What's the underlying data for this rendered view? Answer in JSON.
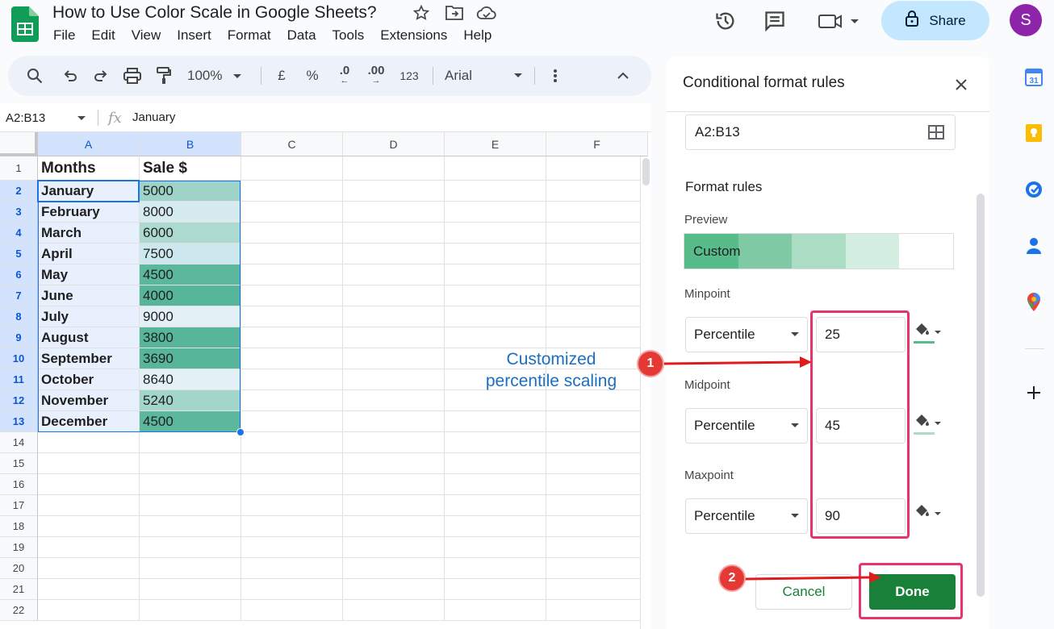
{
  "app": {
    "title": "How to Use Color Scale in Google Sheets?",
    "menu": [
      "File",
      "Edit",
      "View",
      "Insert",
      "Format",
      "Data",
      "Tools",
      "Extensions",
      "Help"
    ],
    "share_label": "Share",
    "avatar_initial": "S"
  },
  "toolbar": {
    "zoom": "100%",
    "currency": "£",
    "percent": "%",
    "dec_decrease": ".0",
    "dec_increase": ".00",
    "number_format": "123",
    "font": "Arial"
  },
  "formula_bar": {
    "name_box": "A2:B13",
    "fx": "fx",
    "content": "January"
  },
  "sheet": {
    "columns": [
      "A",
      "B",
      "C",
      "D",
      "E",
      "F"
    ],
    "rows": [
      "1",
      "2",
      "3",
      "4",
      "5",
      "6",
      "7",
      "8",
      "9",
      "10",
      "11",
      "12",
      "13",
      "14",
      "15",
      "16",
      "17",
      "18",
      "19",
      "20",
      "21",
      "22"
    ],
    "header": {
      "a": "Months",
      "b": "Sale $"
    },
    "data": [
      {
        "month": "January",
        "sale": "5000",
        "color": "#9dd4c7"
      },
      {
        "month": "February",
        "sale": "8000",
        "color": "#d6ebf0"
      },
      {
        "month": "March",
        "sale": "6000",
        "color": "#acdad0"
      },
      {
        "month": "April",
        "sale": "7500",
        "color": "#cde8ee"
      },
      {
        "month": "May",
        "sale": "4500",
        "color": "#5bb89d"
      },
      {
        "month": "June",
        "sale": "4000",
        "color": "#57b69a"
      },
      {
        "month": "July",
        "sale": "9000",
        "color": "#e3f0f6"
      },
      {
        "month": "August",
        "sale": "3800",
        "color": "#57b69a"
      },
      {
        "month": "September",
        "sale": "3690",
        "color": "#57b69a"
      },
      {
        "month": "October",
        "sale": "8640",
        "color": "#e3f0f6"
      },
      {
        "month": "November",
        "sale": "5240",
        "color": "#a3d6cb"
      },
      {
        "month": "December",
        "sale": "4500",
        "color": "#5bb89d"
      }
    ]
  },
  "annotations": {
    "callout_line1": "Customized",
    "callout_line2": "percentile scaling",
    "badge1": "1",
    "badge2": "2"
  },
  "panel": {
    "title": "Conditional format rules",
    "range": "A2:B13",
    "format_rules_label": "Format rules",
    "preview_label": "Preview",
    "preview_text": "Custom",
    "preview_colors": [
      "#57bb8a",
      "#7fcaa5",
      "#abdcc4",
      "#d5eee2",
      "#ffffff"
    ],
    "minpoint": {
      "label": "Minpoint",
      "type": "Percentile",
      "value": "25",
      "color": "#57bb8a"
    },
    "midpoint": {
      "label": "Midpoint",
      "type": "Percentile",
      "value": "45",
      "color": "#abdcc4"
    },
    "maxpoint": {
      "label": "Maxpoint",
      "type": "Percentile",
      "value": "90",
      "color": "#ffffff"
    },
    "cancel_label": "Cancel",
    "done_label": "Done"
  },
  "colors": {
    "accent": "#188038",
    "share_bg": "#c2e7ff",
    "highlight": "#e8336b",
    "arrow": "#e01b1b"
  }
}
